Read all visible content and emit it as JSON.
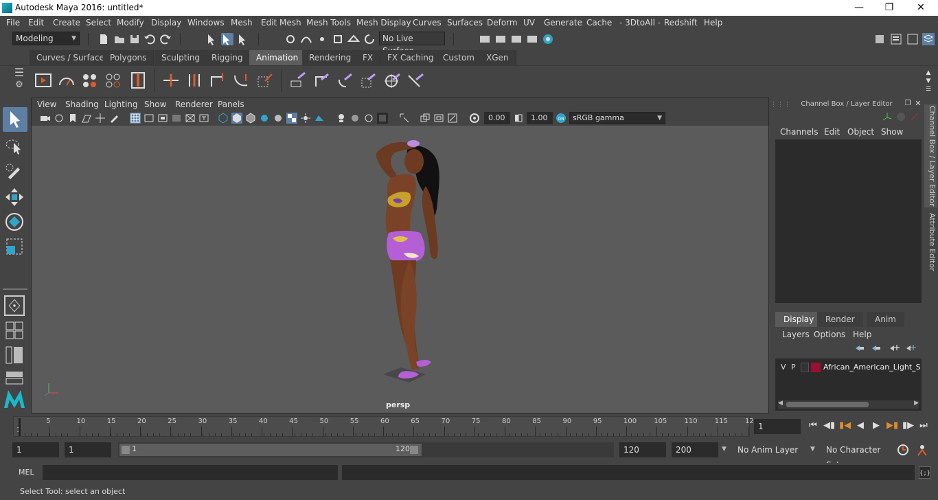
{
  "window": {
    "title": "Autodesk Maya 2016: untitled*"
  },
  "menubar": {
    "items": [
      "File",
      "Edit",
      "Create",
      "Select",
      "Modify",
      "Display",
      "Windows",
      "Mesh",
      "Edit Mesh",
      "Mesh Tools",
      "Mesh Display",
      "Curves",
      "Surfaces",
      "Deform",
      "UV",
      "Generate",
      "Cache",
      "- 3DtoAll -",
      "Redshift",
      "Help"
    ]
  },
  "statusline": {
    "mode": "Modeling",
    "live_surface": "No Live Surface"
  },
  "shelf": {
    "tabs": [
      "Curves / Surfaces",
      "Polygons",
      "Sculpting",
      "Rigging",
      "Animation",
      "Rendering",
      "FX",
      "FX Caching",
      "Custom",
      "XGen"
    ],
    "active_tab": "Animation"
  },
  "viewport": {
    "menu": [
      "View",
      "Shading",
      "Lighting",
      "Show",
      "Renderer",
      "Panels"
    ],
    "exposure": "0.00",
    "gamma": "1.00",
    "colorspace": "sRGB gamma",
    "camera": "persp"
  },
  "channelbox": {
    "title": "Channel Box / Layer Editor",
    "menu": [
      "Channels",
      "Edit",
      "Object",
      "Show"
    ]
  },
  "layers": {
    "tabs": [
      "Display",
      "Render",
      "Anim"
    ],
    "active_tab": "Display",
    "menu": [
      "Layers",
      "Options",
      "Help"
    ],
    "rows": [
      {
        "v": "V",
        "p": "P",
        "name": "African_American_Light_Ski",
        "color": "#9b1030"
      }
    ]
  },
  "side_tabs": [
    "Channel Box / Layer Editor",
    "Attribute Editor"
  ],
  "timeline": {
    "ticks": [
      "1",
      "5",
      "10",
      "15",
      "20",
      "25",
      "30",
      "35",
      "40",
      "45",
      "50",
      "55",
      "60",
      "65",
      "70",
      "75",
      "80",
      "85",
      "90",
      "95",
      "100",
      "105",
      "110",
      "115",
      "12"
    ],
    "current_frame": "1"
  },
  "range": {
    "start": "1",
    "playback_start": "1",
    "slider_start": "1",
    "slider_end": "120",
    "playback_end": "120",
    "end": "200",
    "anim_layer": "No Anim Layer",
    "character_set": "No Character Set"
  },
  "cmdline": {
    "label": "MEL"
  },
  "helpline": {
    "text": "Select Tool: select an object"
  }
}
